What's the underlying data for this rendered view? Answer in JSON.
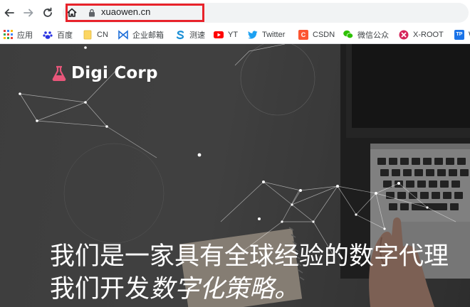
{
  "browser": {
    "address_bar": {
      "url": "xuaowen.cn"
    },
    "highlight_color": "#e8232b"
  },
  "bookmarks": [
    {
      "label": "应用",
      "icon": "apps-grid-icon"
    },
    {
      "label": "百度",
      "icon": "baidu-paw-icon"
    },
    {
      "label": "CN",
      "icon": "folder-icon"
    },
    {
      "label": "企业邮箱",
      "icon": "mail-bowtie-icon"
    },
    {
      "label": "测速",
      "icon": "speedtest-s-icon"
    },
    {
      "label": "YT",
      "icon": "youtube-icon"
    },
    {
      "label": "Twitter",
      "icon": "twitter-bird-icon"
    },
    {
      "label": "CSDN",
      "icon": "csdn-c-icon"
    },
    {
      "label": "微信公众",
      "icon": "wechat-icon"
    },
    {
      "label": "X-ROOT",
      "icon": "xroot-icon"
    },
    {
      "label": "W",
      "icon": "tp-icon"
    }
  ],
  "site": {
    "logo_text": "Digi Corp",
    "logo_icon": "flask-icon",
    "brand_color": "#e8567a",
    "headline_line1": "我们是一家具有全球经验的数字代理",
    "headline_line2_plain": "我们开发",
    "headline_line2_italic": "数字化策略。"
  }
}
